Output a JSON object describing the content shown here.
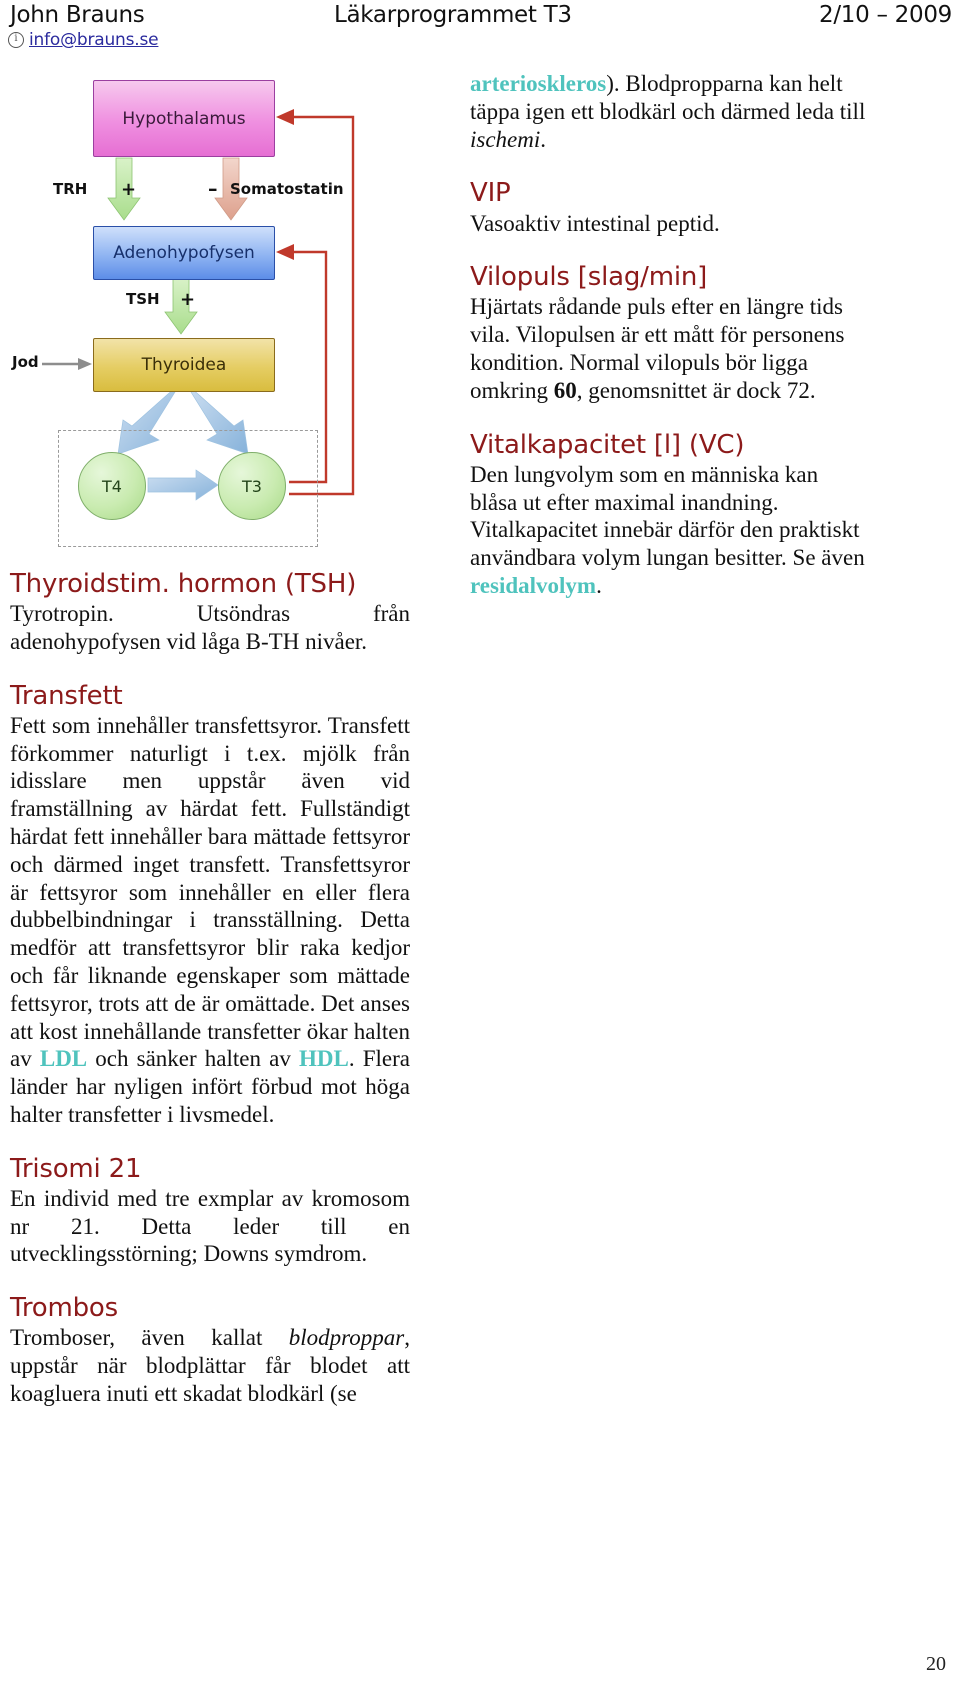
{
  "header": {
    "author": "John Brauns",
    "course": "Läkarprogrammet T3",
    "date": "2/10 – 2009",
    "email": "info@brauns.se",
    "email_icon": "info-circle-icon"
  },
  "diagram": {
    "name": "thyroid-axis-diagram",
    "nodes": {
      "hypothalamus": "Hypothalamus",
      "adenohypofysen": "Adenohypofysen",
      "thyroidea": "Thyroidea",
      "t4": "T4",
      "t3": "T3"
    },
    "labels": {
      "trh": "TRH",
      "plus_trh": "+",
      "minus_somatostatin": "–",
      "somatostatin": "Somatostatin",
      "tsh": "TSH",
      "plus_tsh": "+",
      "jod": "Jod"
    },
    "colors": {
      "hypothalamus_fill": "#ef8fe0",
      "adenohypofysen_fill": "#8fb4f2",
      "thyroidea_fill": "#e5cd63",
      "hormone_circle_fill": "#c9ebb0",
      "feedback_arrow": "#c0392b",
      "positive_arrow": "#b8e5a0",
      "negative_arrow": "#e0a898",
      "conversion_arrow": "#a8c8e8",
      "jod_arrow": "#9a9a9a"
    }
  },
  "left_column": {
    "entries": [
      {
        "heading": "Thyroidstim. hormon (TSH)",
        "body_parts": [
          {
            "t": "Tyrotropin. Utsöndras från adenohypofysen vid låga B-TH nivåer.",
            "style": "plain"
          }
        ]
      },
      {
        "heading": "Transfett",
        "body_parts": [
          {
            "t": "Fett som innehåller transfettsyror. Transfett förkommer naturligt i t.ex. mjölk från idisslare men uppstår även vid framställning av härdat fett. Fullständigt härdat fett innehåller bara mättade fettsyror och därmed inget transfett. Transfettsyror är fettsyror som innehåller en eller flera dubbelbindningar i transställning. Detta medför att transfettsyror blir raka kedjor och får liknande egenskaper som mättade fettsyror, trots att de är omättade. Det anses att kost innehållande transfetter ökar halten av ",
            "style": "plain"
          },
          {
            "t": "LDL",
            "style": "term"
          },
          {
            "t": " och sänker halten av ",
            "style": "plain"
          },
          {
            "t": "HDL",
            "style": "term"
          },
          {
            "t": ". Flera länder har nyligen infört förbud mot höga halter transfetter i livsmedel.",
            "style": "plain"
          }
        ]
      },
      {
        "heading": "Trisomi 21",
        "body_parts": [
          {
            "t": "En individ med tre exmplar av kromosom nr 21. Detta leder till en utvecklingsstörning; Downs symdrom.",
            "style": "plain"
          }
        ]
      },
      {
        "heading": "Trombos",
        "body_parts": [
          {
            "t": "Tromboser, även kallat ",
            "style": "plain"
          },
          {
            "t": "blodproppar",
            "style": "italic"
          },
          {
            "t": ", uppstår när blodplättar får blodet att koagluera inuti ett skadat blodkärl (se",
            "style": "plain"
          }
        ]
      }
    ]
  },
  "right_column": {
    "continuation": [
      {
        "t": "arterioskleros",
        "style": "term"
      },
      {
        "t": "). Blodpropparna kan helt täppa igen ett blodkärl och därmed leda till ",
        "style": "plain"
      },
      {
        "t": "ischemi",
        "style": "italic"
      },
      {
        "t": ".",
        "style": "plain"
      }
    ],
    "entries": [
      {
        "heading": "VIP",
        "body_parts": [
          {
            "t": "Vasoaktiv intestinal peptid.",
            "style": "plain"
          }
        ]
      },
      {
        "heading": "Vilopuls [slag/min]",
        "body_parts": [
          {
            "t": "Hjärtats rådande puls efter en längre tids vila. Vilopulsen är ett mått för personens kondition. Normal vilopuls bör ligga omkring ",
            "style": "plain"
          },
          {
            "t": "60",
            "style": "bold"
          },
          {
            "t": ", genomsnittet är dock 72.",
            "style": "plain"
          }
        ]
      },
      {
        "heading": "Vitalkapacitet [l] (VC)",
        "body_parts": [
          {
            "t": "Den lungvolym som en människa kan blåsa ut efter maximal inandning. Vitalkapacitet innebär därför den praktiskt användbara volym lungan besitter. Se även ",
            "style": "plain"
          },
          {
            "t": "residalvolym",
            "style": "term"
          },
          {
            "t": ".",
            "style": "plain"
          }
        ]
      }
    ]
  },
  "footer": {
    "page_number": "20"
  },
  "colors": {
    "heading": "#8c1a1a",
    "term_link": "#4fc3bd",
    "email_link": "#2b2b9e"
  }
}
